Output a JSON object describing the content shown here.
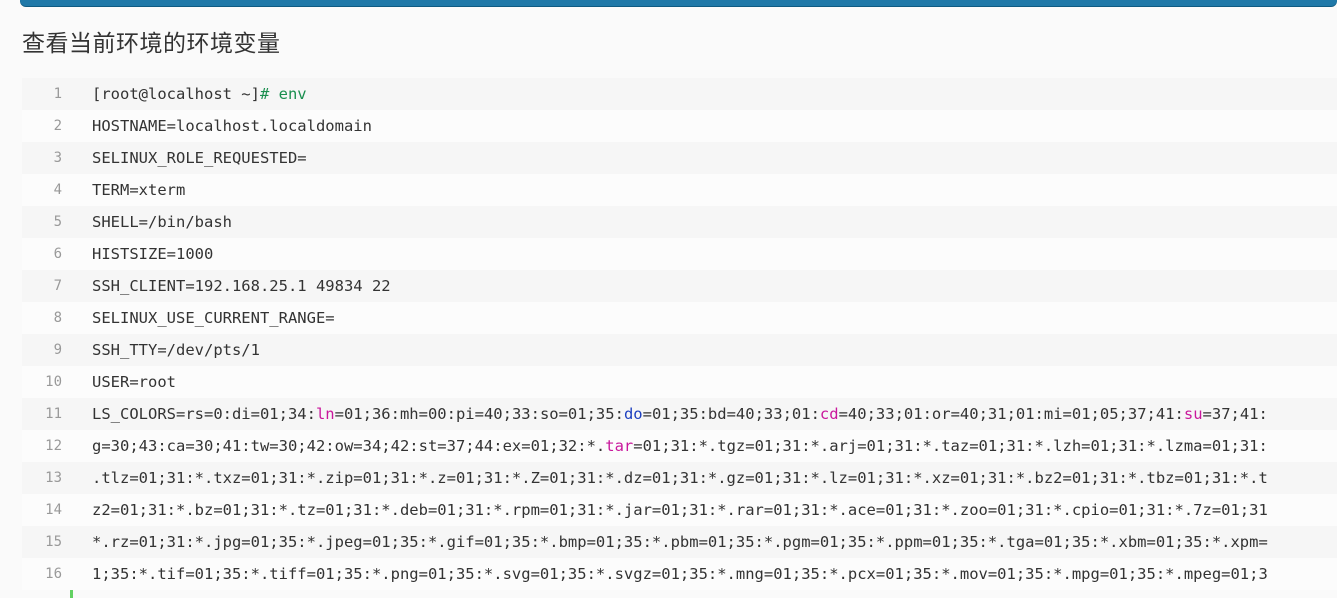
{
  "heading": "查看当前环境的环境变量",
  "code": {
    "lines": [
      {
        "n": "1",
        "segments": [
          [
            "[root@localhost ~]",
            ""
          ],
          [
            "# env",
            "hash"
          ]
        ]
      },
      {
        "n": "2",
        "segments": [
          [
            "HOSTNAME=localhost.localdomain",
            ""
          ]
        ]
      },
      {
        "n": "3",
        "segments": [
          [
            "SELINUX_ROLE_REQUESTED=",
            ""
          ]
        ]
      },
      {
        "n": "4",
        "segments": [
          [
            "TERM=xterm",
            ""
          ]
        ]
      },
      {
        "n": "5",
        "segments": [
          [
            "SHELL=/bin/bash",
            ""
          ]
        ]
      },
      {
        "n": "6",
        "segments": [
          [
            "HISTSIZE=1000",
            ""
          ]
        ]
      },
      {
        "n": "7",
        "segments": [
          [
            "SSH_CLIENT=192.168.25.1 49834 22",
            ""
          ]
        ]
      },
      {
        "n": "8",
        "segments": [
          [
            "SELINUX_USE_CURRENT_RANGE=",
            ""
          ]
        ]
      },
      {
        "n": "9",
        "segments": [
          [
            "SSH_TTY=/dev/pts/1",
            ""
          ]
        ]
      },
      {
        "n": "10",
        "segments": [
          [
            "USER=root",
            ""
          ]
        ]
      },
      {
        "n": "11",
        "segments": [
          [
            "LS_COLORS=rs=0:di=01;34:",
            ""
          ],
          [
            "ln",
            "pink"
          ],
          [
            "=01;36:mh=00:pi=40;33:so=01;35:",
            ""
          ],
          [
            "do",
            "blue"
          ],
          [
            "=01;35:bd=40;33;01:",
            ""
          ],
          [
            "cd",
            "pink"
          ],
          [
            "=40;33;01:or=40;31;01:mi=01;05;37;41:",
            ""
          ],
          [
            "su",
            "pink"
          ],
          [
            "=37;41:",
            ""
          ]
        ]
      },
      {
        "n": "12",
        "segments": [
          [
            "g=30;43:ca=30;41:tw=30;42:ow=34;42:st=37;44:ex=01;32:*.",
            ""
          ],
          [
            "tar",
            "pink"
          ],
          [
            "=01;31:*.tgz=01;31:*.arj=01;31:*.taz=01;31:*.lzh=01;31:*.lzma=01;31:",
            ""
          ]
        ]
      },
      {
        "n": "13",
        "segments": [
          [
            ".tlz=01;31:*.txz=01;31:*.zip=01;31:*.z=01;31:*.Z=01;31:*.dz=01;31:*.gz=01;31:*.lz=01;31:*.xz=01;31:*.bz2=01;31:*.tbz=01;31:*.t",
            ""
          ]
        ]
      },
      {
        "n": "14",
        "segments": [
          [
            "z2=01;31:*.bz=01;31:*.tz=01;31:*.deb=01;31:*.rpm=01;31:*.jar=01;31:*.rar=01;31:*.ace=01;31:*.zoo=01;31:*.cpio=01;31:*.7z=01;31",
            ""
          ]
        ]
      },
      {
        "n": "15",
        "segments": [
          [
            "*.rz=01;31:*.jpg=01;35:*.jpeg=01;35:*.gif=01;35:*.bmp=01;35:*.pbm=01;35:*.pgm=01;35:*.ppm=01;35:*.tga=01;35:*.xbm=01;35:*.xpm=",
            ""
          ]
        ]
      },
      {
        "n": "16",
        "segments": [
          [
            "1;35:*.tif=01;35:*.tiff=01;35:*.png=01;35:*.svg=01;35:*.svgz=01;35:*.mng=01;35:*.pcx=01;35:*.mov=01;35:*.mpg=01;35:*.mpeg=01;3",
            ""
          ]
        ]
      }
    ]
  }
}
